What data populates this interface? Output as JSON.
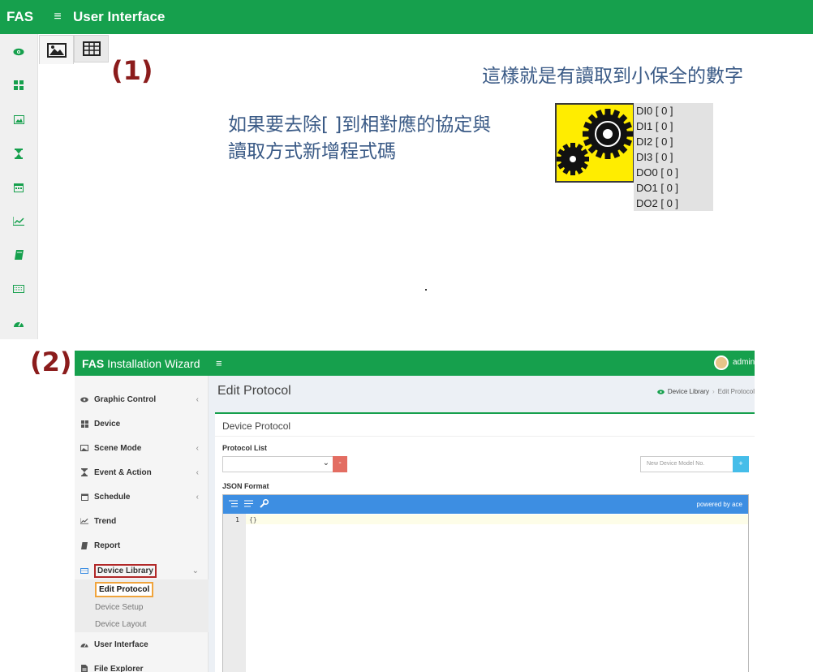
{
  "top_app": {
    "brand": "FAS",
    "title": "User Interface",
    "sidebar_icons": [
      "eye-icon",
      "grid-icon",
      "image-icon",
      "hourglass-icon",
      "calendar-icon",
      "chart-line-icon",
      "book-icon",
      "keyboard-icon",
      "dashboard-icon"
    ],
    "toolbar_icons": [
      "image-icon",
      "table-icon"
    ]
  },
  "label1": "(1)",
  "label2": "(2)",
  "annotation_right": "這樣就是有讀取到小保全的數字",
  "annotation_mid": {
    "line1": "如果要去除[ ]到相對應的協定與",
    "line2": "讀取方式新增程式碼"
  },
  "io_values": [
    "DI0 [ 0 ]",
    "DI1 [ 0 ]",
    "DI2 [ 0 ]",
    "DI3 [ 0 ]",
    "DO0 [ 0 ]",
    "DO1 [ 0 ]",
    "DO2 [ 0 ]"
  ],
  "wizard": {
    "brand_prefix": "FAS",
    "brand_suffix": "Installation Wizard",
    "menu_icon": "≡",
    "user": "admin",
    "sidebar": [
      {
        "label": "Graphic Control",
        "icon": "eye-icon",
        "chevron": "‹"
      },
      {
        "label": "Device",
        "icon": "grid-icon",
        "chevron": ""
      },
      {
        "label": "Scene Mode",
        "icon": "image-icon",
        "chevron": "‹"
      },
      {
        "label": "Event & Action",
        "icon": "hourglass-icon",
        "chevron": "‹"
      },
      {
        "label": "Schedule",
        "icon": "calendar-icon",
        "chevron": "‹"
      },
      {
        "label": "Trend",
        "icon": "chart-line-icon",
        "chevron": ""
      },
      {
        "label": "Report",
        "icon": "book-icon",
        "chevron": ""
      },
      {
        "label": "Device Library",
        "icon": "keyboard-icon",
        "chevron": "⌄"
      },
      {
        "label": "User Interface",
        "icon": "dashboard-icon",
        "chevron": ""
      },
      {
        "label": "File Explorer",
        "icon": "file-icon",
        "chevron": ""
      }
    ],
    "submenu": [
      "Edit Protocol",
      "Device Setup",
      "Device Layout"
    ],
    "page_title": "Edit Protocol",
    "breadcrumb": {
      "parent": "Device Library",
      "sep": "›",
      "current": "Edit Protocol"
    },
    "box_title": "Device Protocol",
    "protocol_list_label": "Protocol List",
    "minus_label": "-",
    "model_placeholder": "New Device Model No.",
    "plus_label": "+",
    "json_label": "JSON Format",
    "editor": {
      "powered": "powered by ace",
      "line_number": "1",
      "code": "{}"
    }
  },
  "colors": {
    "green": "#16a04d",
    "accent_red": "#8b1c1c",
    "note_blue": "#3a5a86",
    "editor_blue": "#3d8ee2"
  }
}
